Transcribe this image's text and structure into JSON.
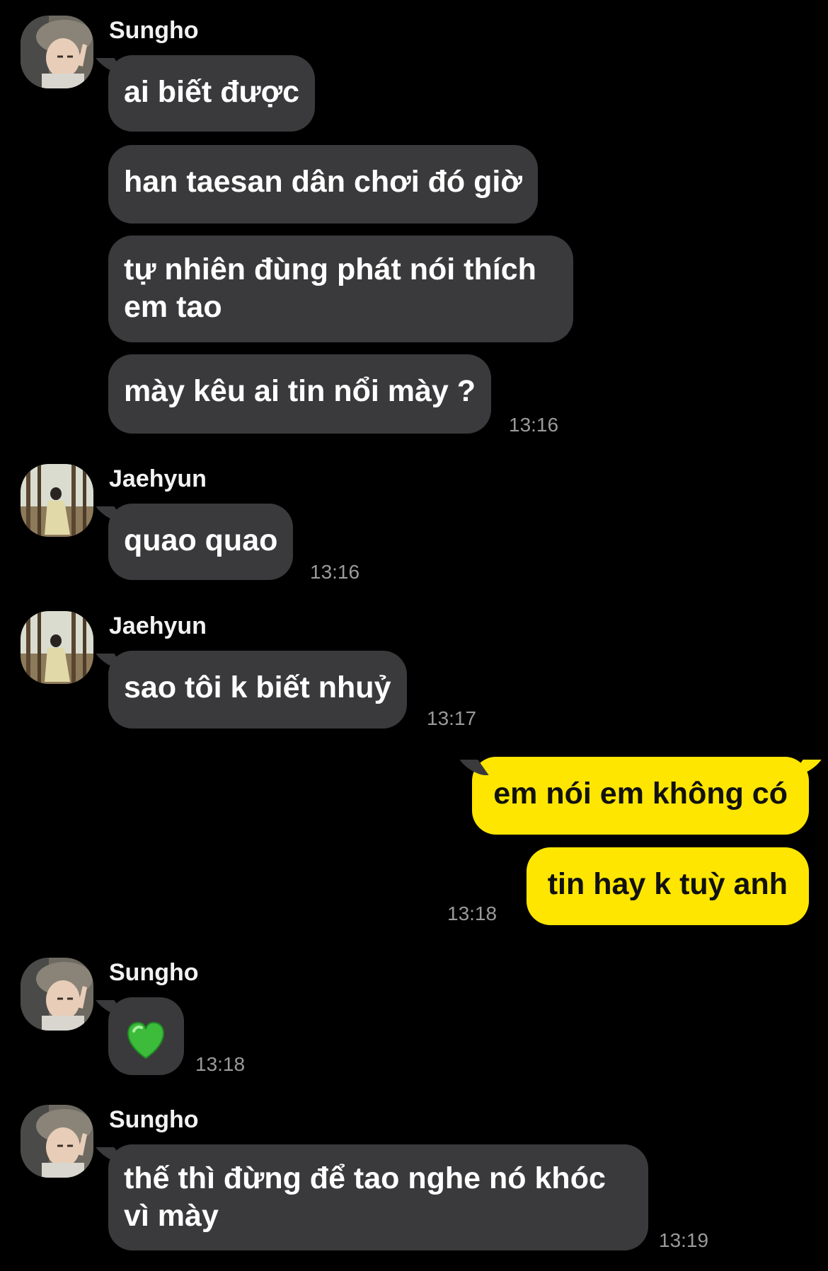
{
  "colors": {
    "background": "#000000",
    "incoming_bubble": "#3a3a3c",
    "outgoing_bubble": "#ffe600",
    "timestamp": "#9a9a9a"
  },
  "messages": {
    "g1": {
      "sender": "Sungho",
      "b1": "ai biết được",
      "b2": "han taesan dân chơi đó giờ",
      "b3": "tự nhiên đùng phát nói thích em tao",
      "b4": "mày kêu ai tin nổi mày ?",
      "time": "13:16"
    },
    "g2": {
      "sender": "Jaehyun",
      "b1": "quao quao",
      "time": "13:16"
    },
    "g3": {
      "sender": "Jaehyun",
      "b1": "sao tôi k biết nhuỷ",
      "time": "13:17"
    },
    "g4": {
      "b1": "em nói em không có",
      "b2": "tin hay k tuỳ anh",
      "time": "13:18"
    },
    "g5": {
      "sender": "Sungho",
      "emoji": "green-heart-emoji",
      "time": "13:18"
    },
    "g6": {
      "sender": "Sungho",
      "b1": "thế thì đừng để tao nghe nó khóc vì mày",
      "time": "13:19"
    }
  }
}
